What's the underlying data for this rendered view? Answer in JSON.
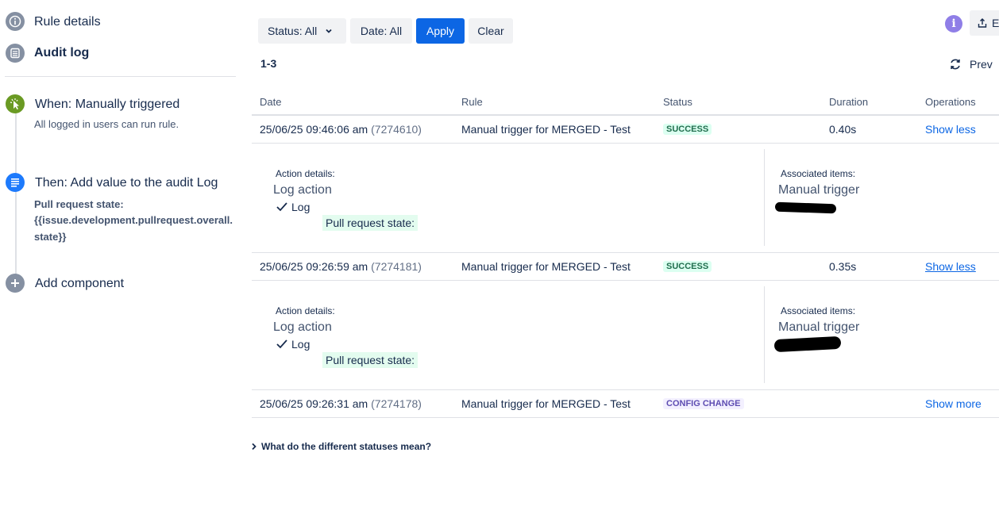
{
  "sidebar": {
    "rule_details_label": "Rule details",
    "audit_log_label": "Audit log",
    "steps": {
      "trigger_title": "When: Manually triggered",
      "trigger_sub": "All logged in users can run rule.",
      "action_title": "Then: Add value to the audit Log",
      "action_detail_line1": "Pull request state:",
      "action_detail_line2": "{{issue.development.pullrequest.overall.state}}",
      "add_component": "Add component"
    }
  },
  "toolbar": {
    "status_filter": "Status: All",
    "date_filter": "Date: All",
    "apply": "Apply",
    "clear": "Clear",
    "info_icon": "i",
    "export_label": "E"
  },
  "pagination": {
    "range": "1-3",
    "prev": "Prev"
  },
  "table": {
    "headers": {
      "date": "Date",
      "rule": "Rule",
      "status": "Status",
      "duration": "Duration",
      "operations": "Operations"
    },
    "rows": [
      {
        "date": "25/06/25 09:46:06 am",
        "id": "(7274610)",
        "rule": "Manual trigger for MERGED - Test",
        "status": "SUCCESS",
        "duration": "0.40s",
        "operation": "Show less",
        "details": {
          "action_label": "Action details:",
          "action_name": "Log action",
          "log_label": "Log",
          "log_text": "Pull request state:",
          "assoc_label": "Associated items:",
          "assoc_item": "Manual trigger"
        }
      },
      {
        "date": "25/06/25 09:26:59 am",
        "id": "(7274181)",
        "rule": "Manual trigger for MERGED - Test",
        "status": "SUCCESS",
        "duration": "0.35s",
        "operation": "Show less",
        "details": {
          "action_label": "Action details:",
          "action_name": "Log action",
          "log_label": "Log",
          "log_text": "Pull request state:",
          "assoc_label": "Associated items:",
          "assoc_item": "Manual trigger"
        }
      },
      {
        "date": "25/06/25 09:26:31 am",
        "id": "(7274178)",
        "rule": "Manual trigger for MERGED - Test",
        "status": "CONFIG CHANGE",
        "duration": "",
        "operation": "Show more"
      }
    ]
  },
  "footer": {
    "statuses_help": "What do the different statuses mean?"
  },
  "colors": {
    "primary": "#0c66e4",
    "success_bg": "#dcfff1",
    "success_text": "#216e4e",
    "config_bg": "#f3f0ff",
    "config_text": "#5e4db2",
    "trigger_green": "#6a9a23",
    "action_blue": "#1d7afc"
  },
  "icons": {
    "rule_details": "info-icon",
    "audit_log": "list-icon",
    "trigger": "cursor-click-icon",
    "action": "document-icon",
    "add": "plus-icon",
    "refresh": "refresh-icon"
  }
}
